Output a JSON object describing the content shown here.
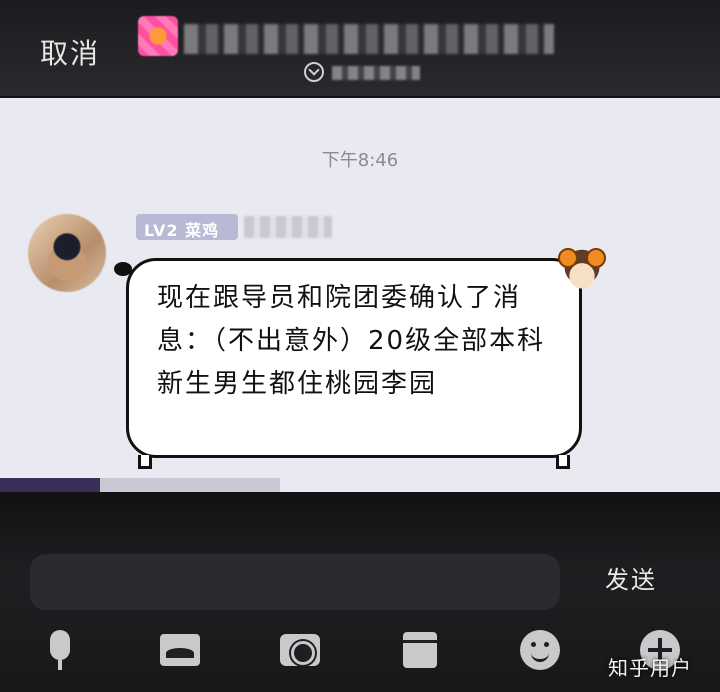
{
  "header": {
    "cancel_label": "取消"
  },
  "chat": {
    "timestamp": "下午8:46",
    "message": {
      "sender_level": "LV2 菜鸡",
      "text": "现在跟导员和院团委确认了消息：（不出意外）20级全部本科新生男生都住桃园李园"
    }
  },
  "input_bar": {
    "send_label": "发送",
    "tools": [
      {
        "icon": "microphone-icon"
      },
      {
        "icon": "image-icon"
      },
      {
        "icon": "camera-icon"
      },
      {
        "icon": "card-icon"
      },
      {
        "icon": "emoji-icon"
      },
      {
        "icon": "plus-icon"
      }
    ]
  },
  "watermark": "知乎用户",
  "colors": {
    "topbar_bg": "#1c1c1f",
    "chat_bg": "#e9e9f1",
    "bubble_bg": "#ffffff",
    "level_badge": "#b9b9d6",
    "bottombar_bg": "#1f1f22"
  }
}
